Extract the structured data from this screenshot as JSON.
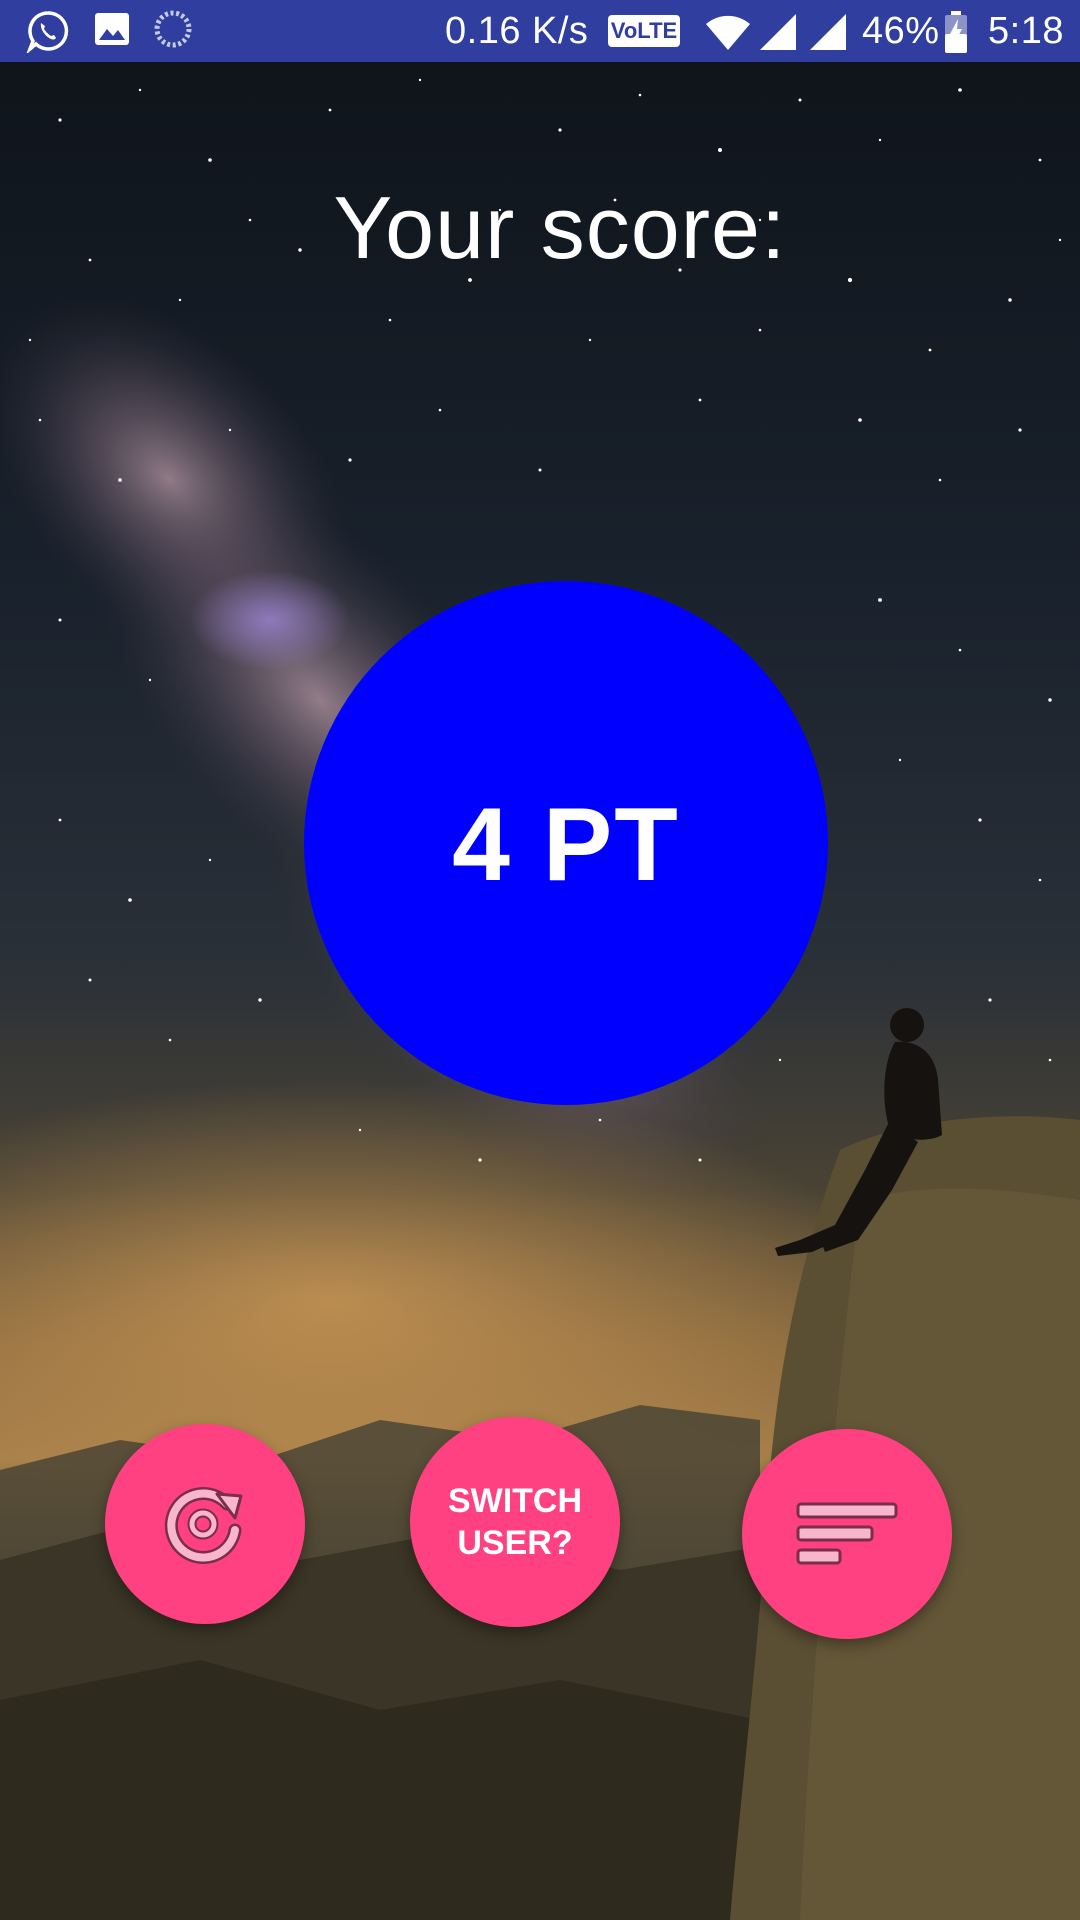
{
  "status_bar": {
    "net_speed": "0.16 K/s",
    "volte_badge": "VoLTE",
    "battery_percent": "46%",
    "time": "5:18",
    "left_icons": [
      "whatsapp-icon",
      "gallery-icon",
      "sync-icon"
    ],
    "right_icons": [
      "volte-icon",
      "wifi-icon",
      "signal-icon",
      "signal-icon",
      "battery-charging-icon"
    ],
    "background_color": "#303f9f"
  },
  "screen": {
    "title": "Your score:",
    "score": "4 PT",
    "score_circle_color": "#0000ff"
  },
  "actions": {
    "replay_icon": "replay-icon",
    "switch_user_label_line1": "SWITCH",
    "switch_user_label_line2": "USER?",
    "leaderboard_icon": "sort-list-icon",
    "button_color": "#ff4081"
  }
}
